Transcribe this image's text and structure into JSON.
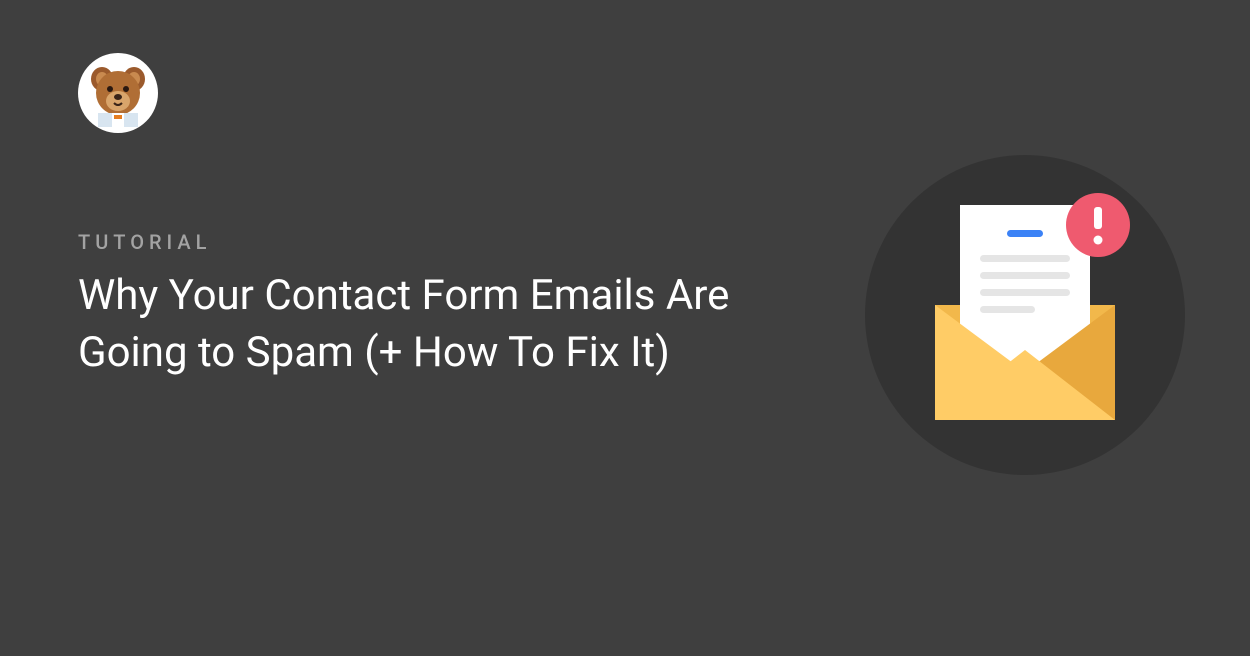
{
  "category": "TUTORIAL",
  "title": "Why Your Contact Form Emails Are Going to Spam (+ How To Fix It)",
  "avatar_name": "wpforms-bear-avatar",
  "illustration_name": "email-spam-alert-icon",
  "colors": {
    "background": "#3f3f3f",
    "circle_bg": "#333333",
    "envelope_back": "#f2b84b",
    "envelope_front_left": "#ffcc66",
    "envelope_flap_right": "#e8a83d",
    "paper": "#ffffff",
    "line_blue": "#3b82f6",
    "line_gray": "#e5e5e5",
    "alert_red": "#ef5a6f",
    "alert_dark": "#d94a5f"
  }
}
